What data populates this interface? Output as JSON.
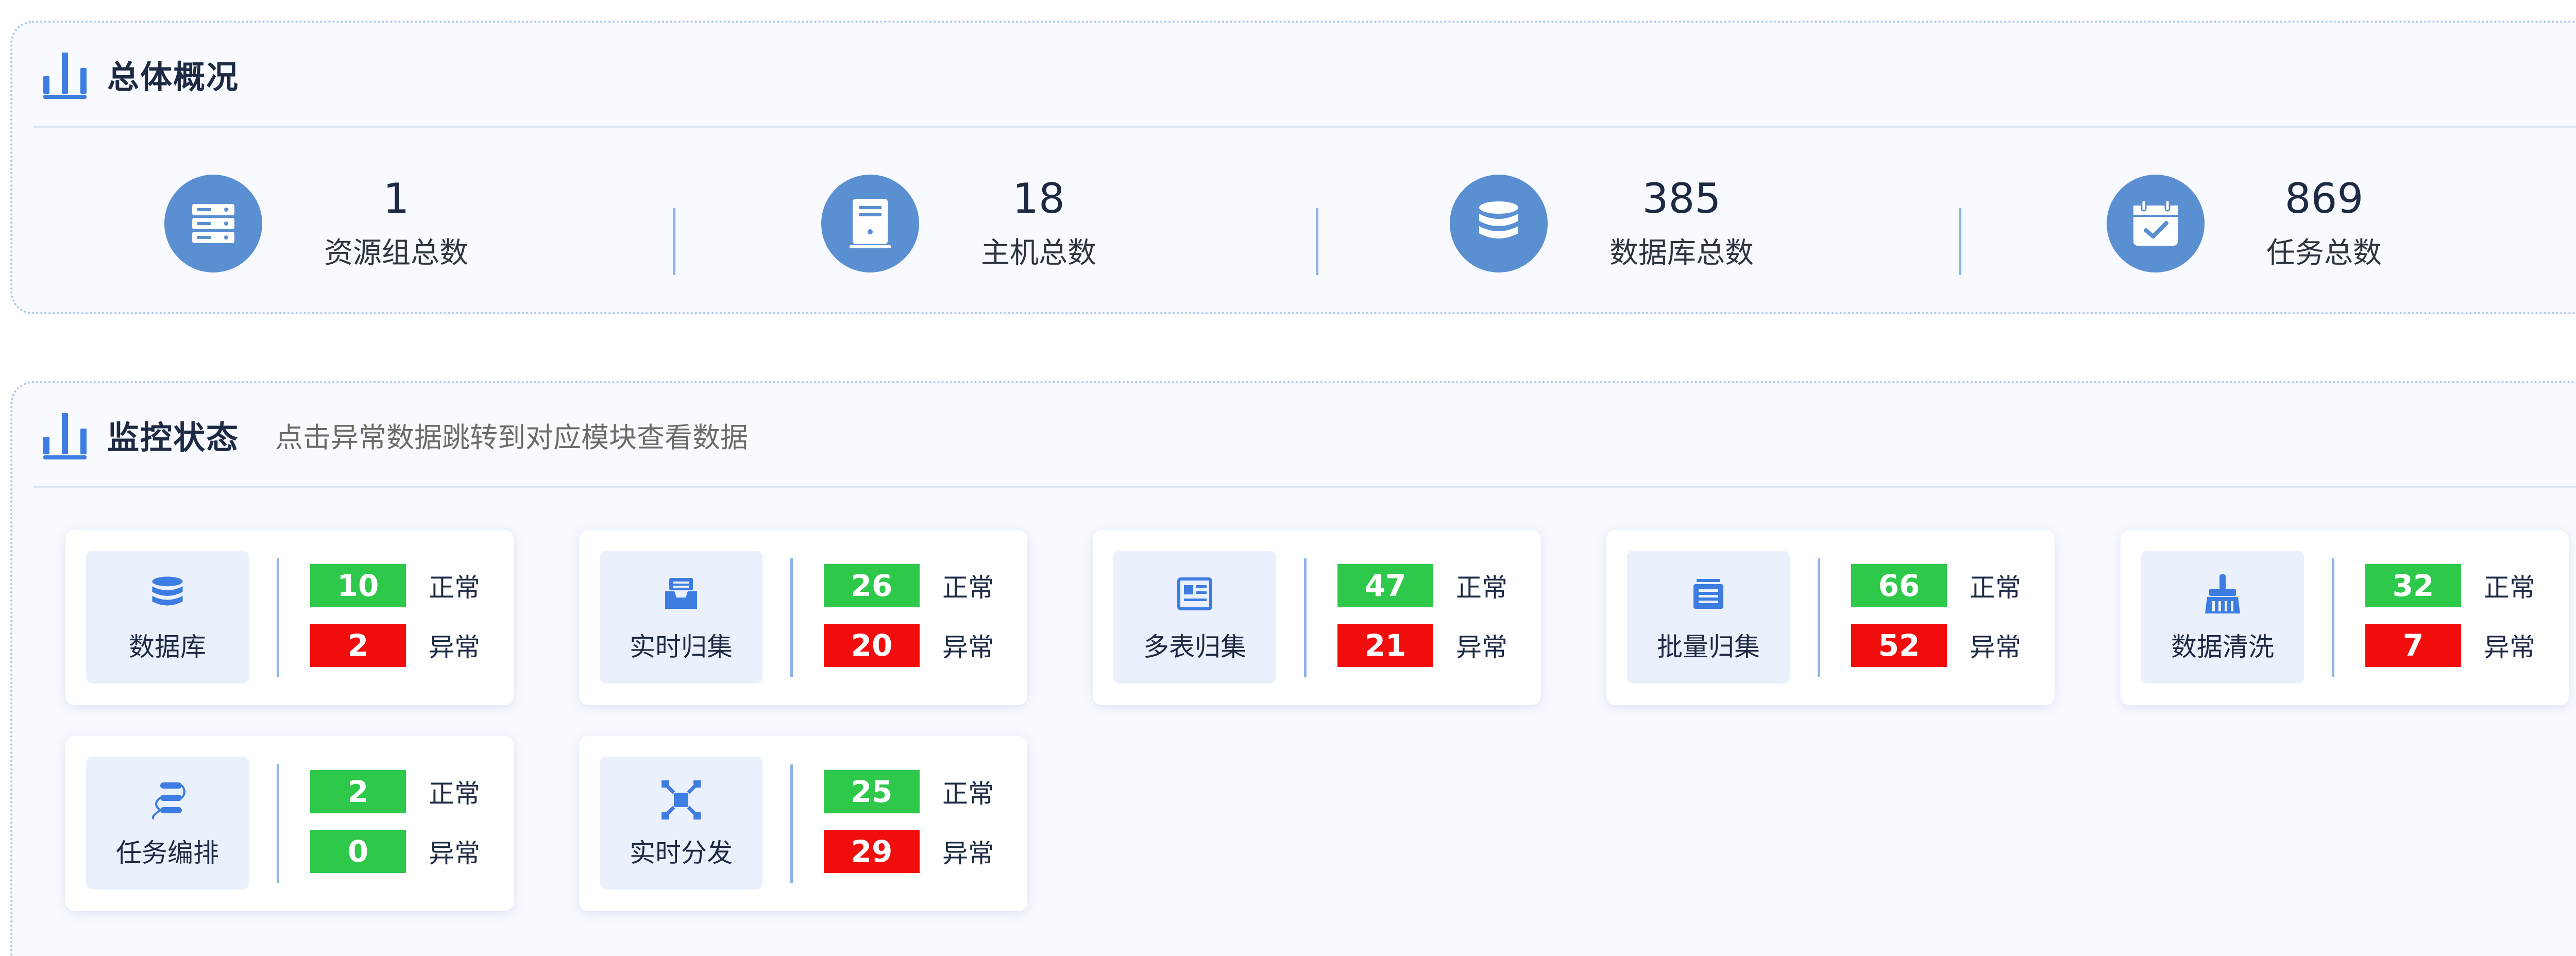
{
  "overview": {
    "title": "总体概况",
    "stats": [
      {
        "value": "1",
        "label": "资源组总数",
        "icon": "server-rack-icon"
      },
      {
        "value": "18",
        "label": "主机总数",
        "icon": "host-icon"
      },
      {
        "value": "385",
        "label": "数据库总数",
        "icon": "database-icon"
      },
      {
        "value": "869",
        "label": "任务总数",
        "icon": "task-calendar-icon"
      }
    ]
  },
  "monitor": {
    "title": "监控状态",
    "subtitle": "点击异常数据跳转到对应模块查看数据",
    "normal_label": "正常",
    "abnormal_label": "异常",
    "cards": [
      {
        "name": "数据库",
        "normal": "10",
        "abnormal": "2",
        "icon": "database-icon"
      },
      {
        "name": "实时归集",
        "normal": "26",
        "abnormal": "20",
        "icon": "inbox-icon"
      },
      {
        "name": "多表归集",
        "normal": "47",
        "abnormal": "21",
        "icon": "multi-table-icon"
      },
      {
        "name": "批量归集",
        "normal": "66",
        "abnormal": "52",
        "icon": "batch-list-icon"
      },
      {
        "name": "数据清洗",
        "normal": "32",
        "abnormal": "7",
        "icon": "broom-icon"
      },
      {
        "name": "任务编排",
        "normal": "2",
        "abnormal": "0",
        "icon": "workflow-icon"
      },
      {
        "name": "实时分发",
        "normal": "25",
        "abnormal": "29",
        "icon": "distribute-icon"
      }
    ]
  },
  "colors": {
    "accent": "#3d7ce0",
    "icon_circle": "#5a8fd2",
    "normal": "#2ec84a",
    "abnormal": "#f20d0d"
  }
}
